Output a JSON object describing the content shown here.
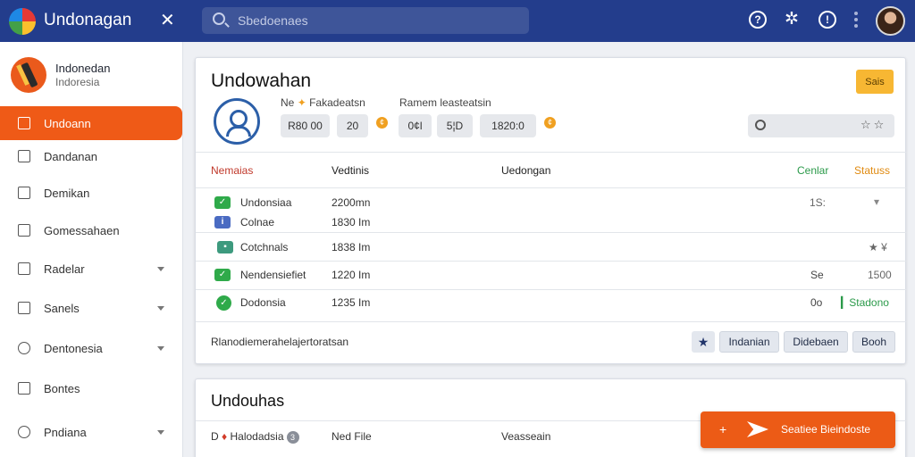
{
  "header": {
    "app_title": "Undonagan",
    "search_placeholder": "Sbedoenaes",
    "icons": [
      "help-icon",
      "star-icon",
      "info-icon",
      "more-icon"
    ]
  },
  "sidebar": {
    "profile_name": "Indonedan",
    "profile_sub": "Indoresia",
    "items": [
      {
        "label": "Undoann",
        "active": true
      },
      {
        "label": "Dandanan"
      },
      {
        "label": "Demikan"
      },
      {
        "label": "Gomessahaen"
      },
      {
        "label": "Radelar"
      },
      {
        "label": "Sanels"
      },
      {
        "label": "Dentonesia"
      },
      {
        "label": "Bontes"
      },
      {
        "label": "Pndiana"
      }
    ]
  },
  "card1": {
    "title": "Undowahan",
    "top_button": "Sais",
    "meta_left": "Ne",
    "meta_left_rest": "Fakadeatsn",
    "meta_right": "Ramem leasteatsin",
    "pills": [
      "R80 00",
      "20",
      "0¢l",
      "5¦D",
      "1820:0"
    ],
    "columns": [
      "Nemaias",
      "Vedtinis",
      "Uedongan",
      "Cenlar",
      "Statuss"
    ],
    "rows": [
      {
        "name": "Undonsiaa",
        "value": "2200mn",
        "extra": "1S:",
        "status": "▾"
      },
      {
        "name": "Colnae",
        "value": "1830 Im",
        "extra": "",
        "status": ""
      },
      {
        "name": "Cotchnals",
        "value": "1838 Im",
        "extra": "",
        "status": "★ ¥"
      },
      {
        "name": "Nendensiefiet",
        "value": "1220 Im",
        "extra": "Se",
        "status": "1500"
      },
      {
        "name": "Dodonsia",
        "value": "1235 Im",
        "extra": "0o",
        "status": "Stadono"
      }
    ],
    "footer_text": "Rlanodiemerahelajertoratsan",
    "footer_buttons": [
      "Indanian",
      "Didebaen",
      "Booh"
    ]
  },
  "card2": {
    "title": "Undouhas",
    "row_name": "Halodadsia",
    "row_badge": "3",
    "row_col2": "Ned File",
    "row_col3": "Veasseain"
  },
  "fab": {
    "label": "Seatiee Bieindoste"
  },
  "colors": {
    "topbar": "#233d8c",
    "accent": "#ef5a17",
    "ok": "#2faa4a",
    "warn": "#f7b733"
  }
}
